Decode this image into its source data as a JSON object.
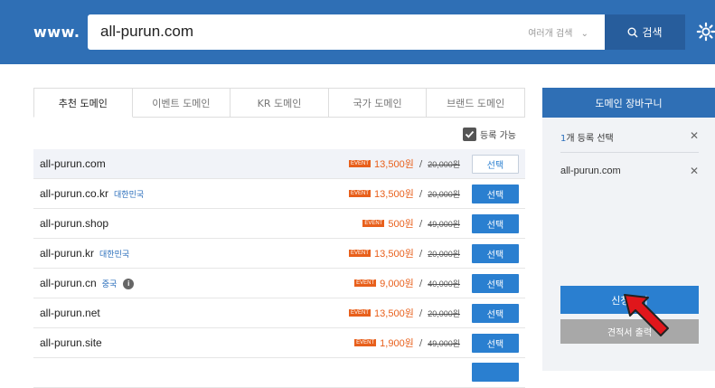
{
  "header": {
    "www_label": "www.",
    "search_value": "all-purun.com",
    "multi_search_label": "여러개 검색",
    "search_button_label": "검색"
  },
  "tabs": [
    {
      "label": "추천 도메인"
    },
    {
      "label": "이벤트 도메인"
    },
    {
      "label": "KR 도메인"
    },
    {
      "label": "국가 도메인"
    },
    {
      "label": "브랜드 도메인"
    }
  ],
  "available_only_label": "등록 가능",
  "domains": [
    {
      "name": "all-purun.com",
      "country": "",
      "event": "EVENT",
      "price": "13,500원",
      "old_price": "20,000원",
      "button": "선택"
    },
    {
      "name": "all-purun.co.kr",
      "country": "대한민국",
      "event": "EVENT",
      "price": "13,500원",
      "old_price": "20,000원",
      "button": "선택"
    },
    {
      "name": "all-purun.shop",
      "country": "",
      "event": "EVENT",
      "price": "500원",
      "old_price": "49,000원",
      "button": "선택"
    },
    {
      "name": "all-purun.kr",
      "country": "대한민국",
      "event": "EVENT",
      "price": "13,500원",
      "old_price": "20,000원",
      "button": "선택"
    },
    {
      "name": "all-purun.cn",
      "country": "중국",
      "event": "EVENT",
      "price": "9,000원",
      "old_price": "40,000원",
      "button": "선택"
    },
    {
      "name": "all-purun.net",
      "country": "",
      "event": "EVENT",
      "price": "13,500원",
      "old_price": "20,000원",
      "button": "선택"
    },
    {
      "name": "all-purun.site",
      "country": "",
      "event": "EVENT",
      "price": "1,900원",
      "old_price": "49,000원",
      "button": "선택"
    }
  ],
  "cart": {
    "title": "도메인 장바구니",
    "count_number": "1",
    "count_text": "개 등록 선택",
    "item": "all-purun.com",
    "apply_button": "신청하기",
    "quote_button": "견적서 출력"
  },
  "colors": {
    "header_bg": "#2f6fb5",
    "primary_button": "#2a7fd0",
    "event_orange": "#e8601c",
    "arrow_red": "#e0161b"
  }
}
